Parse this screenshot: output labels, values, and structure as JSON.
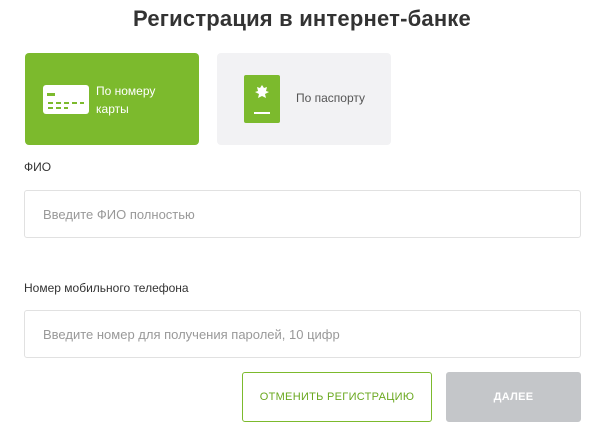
{
  "header": {
    "title": "Регистрация в интернет-банке"
  },
  "methods": {
    "card": {
      "label_line1": "По номеру",
      "label_line2": "карты",
      "icon": "bank-card-icon",
      "selected": true
    },
    "passport": {
      "label": "По паспорту",
      "icon": "passport-icon",
      "selected": false
    }
  },
  "form": {
    "fio": {
      "label": "ФИО",
      "placeholder": "Введите ФИО полностью",
      "value": ""
    },
    "phone": {
      "label": "Номер мобильного телефона",
      "placeholder": "Введите номер для получения паролей, 10 цифр",
      "value": ""
    }
  },
  "actions": {
    "cancel_label": "Отменить регистрацию",
    "next_label": "Далее",
    "next_disabled": true
  },
  "colors": {
    "accent": "#7cba2d",
    "disabled": "#c4c6c9",
    "inactive_card": "#f2f2f4"
  }
}
